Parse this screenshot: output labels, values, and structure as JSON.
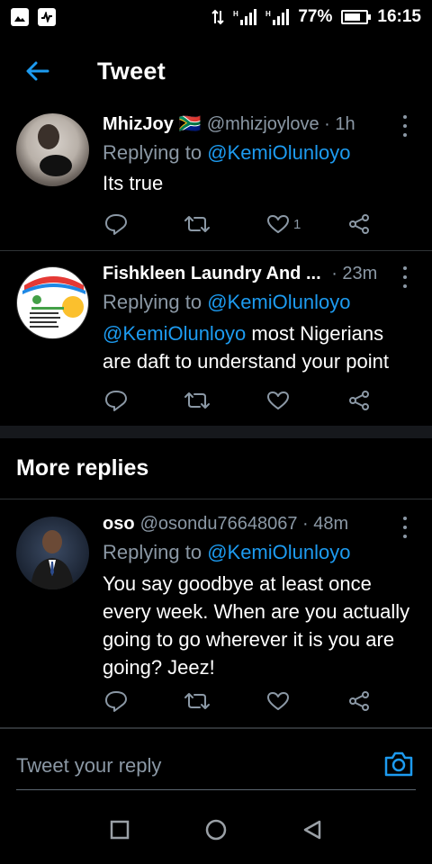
{
  "status_bar": {
    "battery": "77%",
    "battery_level": 0.77,
    "time": "16:15",
    "icons": [
      "image-icon",
      "activity-icon",
      "data-arrows-icon",
      "signal-h-icon",
      "signal-icon",
      "battery-icon"
    ]
  },
  "header": {
    "title": "Tweet",
    "back_icon": "back-arrow-icon"
  },
  "tweets": [
    {
      "name": "MhizJoy",
      "flag": "🇿🇦",
      "handle": "@mhizjoylove",
      "sep": " · ",
      "time": "1h",
      "replying_prefix": "Replying to ",
      "replying_to": "@KemiOlunloyo",
      "text": "Its true",
      "like_count": "1"
    },
    {
      "name": "Fishkleen Laundry And ...",
      "sep": " · ",
      "time": "23m",
      "replying_prefix": "Replying to ",
      "replying_to": "@KemiOlunloyo",
      "mention": "@KemiOlunloyo",
      "text": " most Nigerians are daft to understand your point"
    }
  ],
  "section": {
    "title": "More replies"
  },
  "more_replies": [
    {
      "name": "oso",
      "handle": "@osondu76648067",
      "sep": " · ",
      "time": "48m",
      "replying_prefix": "Replying to ",
      "replying_to": "@KemiOlunloyo",
      "text": "You say goodbye at least once every week. When are you actually going to go wherever it is you are going? Jeez!"
    }
  ],
  "reply_box": {
    "placeholder": "Tweet your reply"
  },
  "colors": {
    "accent": "#1d9bf0",
    "muted": "#8b98a5",
    "background": "#000000"
  }
}
